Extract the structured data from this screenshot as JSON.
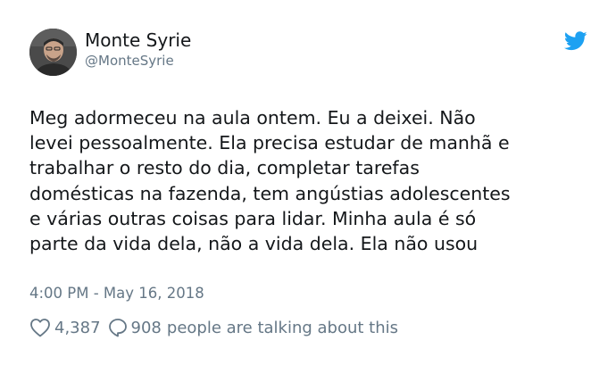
{
  "author": {
    "display_name": "Monte Syrie",
    "handle": "@MonteSyrie"
  },
  "icons": {
    "avatar": "profile-photo",
    "brand": "twitter-bird-icon",
    "like": "heart-icon",
    "reply": "speech-bubble-icon"
  },
  "colors": {
    "brand": "#1da1f2",
    "text": "#14171a",
    "muted": "#657786"
  },
  "tweet": {
    "lines": [
      "Meg adormeceu na aula ontem. Eu a deixei. Não",
      "levei pessoalmente. Ela precisa estudar de manhã e",
      "trabalhar o resto do dia, completar tarefas",
      "domésticas na fazenda, tem angústias adolescentes",
      "e várias outras coisas para lidar. Minha aula é só",
      "parte da vida dela, não a vida dela. Ela não usou"
    ],
    "timestamp": "4:00 PM - May 16, 2018"
  },
  "engagement": {
    "likes": "4,387",
    "replies": "908",
    "talking_text": "people are talking about this"
  }
}
